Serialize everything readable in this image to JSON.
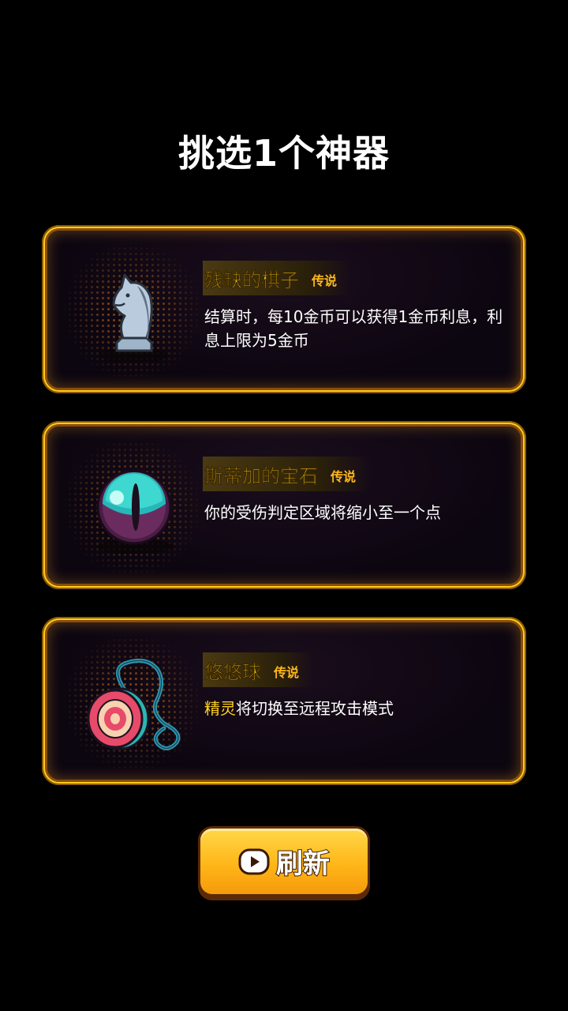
{
  "title": "挑选1个神器",
  "artifacts": [
    {
      "name": "残缺的棋子",
      "rarity": "传说",
      "icon": "chess-knight-icon",
      "description": "结算时，每10金币可以获得1金币利息，利息上限为5金币",
      "desc_prefix": "",
      "desc_rest": "结算时，每10金币可以获得1金币利息，利息上限为5金币"
    },
    {
      "name": "斯蒂加的宝石",
      "rarity": "传说",
      "icon": "gem-orb-icon",
      "description": "你的受伤判定区域将缩小至一个点",
      "desc_prefix": "",
      "desc_rest": "你的受伤判定区域将缩小至一个点"
    },
    {
      "name": "悠悠球",
      "rarity": "传说",
      "icon": "yoyo-icon",
      "description": "精灵将切换至远程攻击模式",
      "desc_prefix": "精灵",
      "desc_rest": "将切换至远程攻击模式"
    }
  ],
  "refresh_button": {
    "label": "刷新",
    "icon": "video-play-icon"
  },
  "colors": {
    "background": "#000000",
    "card_border": "#ffcc1a",
    "name_color": "#ffd21f",
    "button": "#ffb618"
  }
}
